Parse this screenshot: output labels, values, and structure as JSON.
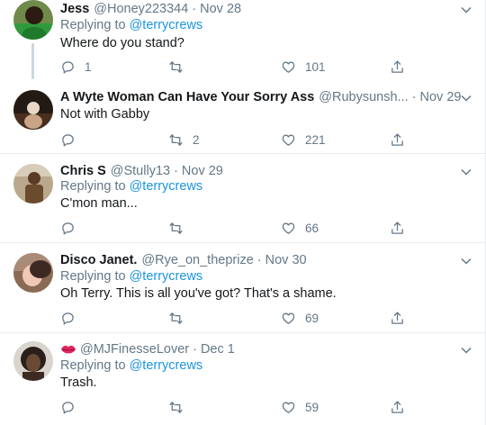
{
  "tweets": [
    {
      "name": "Jess",
      "handle": "@Honey223344",
      "time": "Nov 28",
      "replying_prefix": "Replying to",
      "replying_to": "@terrycrews",
      "text": "Where do you stand?",
      "reply_count": "1",
      "retweet_count": "",
      "like_count": "101"
    },
    {
      "name": "A Wyte Woman Can Have Your Sorry Ass",
      "handle": "@Rubysunsh...",
      "time": "Nov 29",
      "text": "Not with Gabby",
      "reply_count": "",
      "retweet_count": "2",
      "like_count": "221"
    },
    {
      "name": "Chris S",
      "handle": "@Stully13",
      "time": "Nov 29",
      "replying_prefix": "Replying to",
      "replying_to": "@terrycrews",
      "text": "C'mon man...",
      "reply_count": "",
      "retweet_count": "",
      "like_count": "66"
    },
    {
      "name": "Disco Janet.",
      "handle": "@Rye_on_theprize",
      "time": "Nov 30",
      "replying_prefix": "Replying to",
      "replying_to": "@terrycrews",
      "text": "Oh Terry. This is all you've got? That's a shame.",
      "reply_count": "",
      "retweet_count": "",
      "like_count": "69"
    },
    {
      "name": "",
      "handle": "@MJFinesseLover",
      "time": "Dec 1",
      "replying_prefix": "Replying to",
      "replying_to": "@terrycrews",
      "text": "Trash.",
      "reply_count": "",
      "retweet_count": "",
      "like_count": "59"
    }
  ],
  "colors": {
    "text": "#14171a",
    "secondary": "#657786",
    "link": "#1b95e0",
    "border": "#e6ecf0",
    "thread_line": "#ccd6dd"
  },
  "icons": {
    "reply": "reply-icon",
    "retweet": "retweet-icon",
    "like": "heart-icon",
    "share": "share-icon",
    "more": "chevron-down-icon"
  }
}
